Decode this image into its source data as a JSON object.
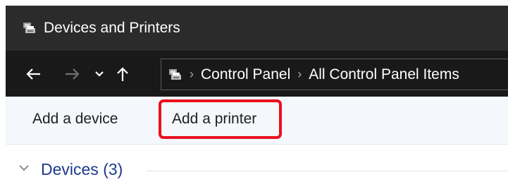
{
  "window": {
    "title": "Devices and Printers",
    "title_icon": "devices-printers-icon"
  },
  "navigation": {
    "back_icon": "arrow-left-icon",
    "forward_icon": "arrow-right-icon",
    "recent_icon": "chevron-down-icon",
    "up_icon": "arrow-up-icon",
    "address": {
      "location_icon": "devices-printers-icon",
      "breadcrumbs": [
        "Control Panel",
        "All Control Panel Items"
      ]
    }
  },
  "commandbar": {
    "add_device_label": "Add a device",
    "add_printer_label": "Add a printer",
    "highlight_color": "#e8111d"
  },
  "group": {
    "label": "Devices (3)",
    "label_color": "#1c3a8c"
  }
}
